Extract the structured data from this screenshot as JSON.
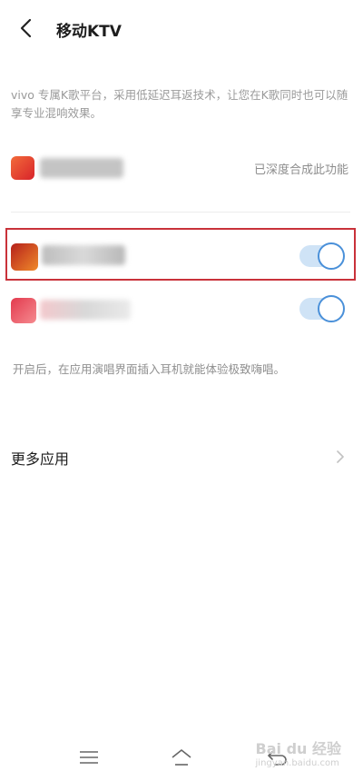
{
  "header": {
    "title": "移动KTV",
    "back_icon": "chevron-left-icon"
  },
  "description": "vivo 专属K歌平台，采用低延迟耳返技术，让您在K歌同时也可以随享专业混响效果。",
  "apps": [
    {
      "name": "",
      "status_text": "已深度合成此功能",
      "toggle": null,
      "icon_color": "#e8432d"
    },
    {
      "name": "",
      "status_text": "",
      "toggle": true,
      "icon_color": "#d23b22"
    },
    {
      "name": "",
      "status_text": "",
      "toggle": true,
      "icon_color": "#e84a5a"
    }
  ],
  "hint": "开启后，在应用演唱界面插入耳机就能体验极致嗨唱。",
  "more": {
    "label": "更多应用",
    "icon": "chevron-right-icon"
  },
  "navbar": {
    "menu_icon": "menu-icon",
    "home_icon": "home-icon",
    "back_icon": "back-icon"
  },
  "watermark": {
    "brand": "Bai du 经验",
    "sub": "jingyan.baidu.com"
  },
  "colors": {
    "accent": "#4a90d9",
    "highlight": "#c9323a"
  }
}
